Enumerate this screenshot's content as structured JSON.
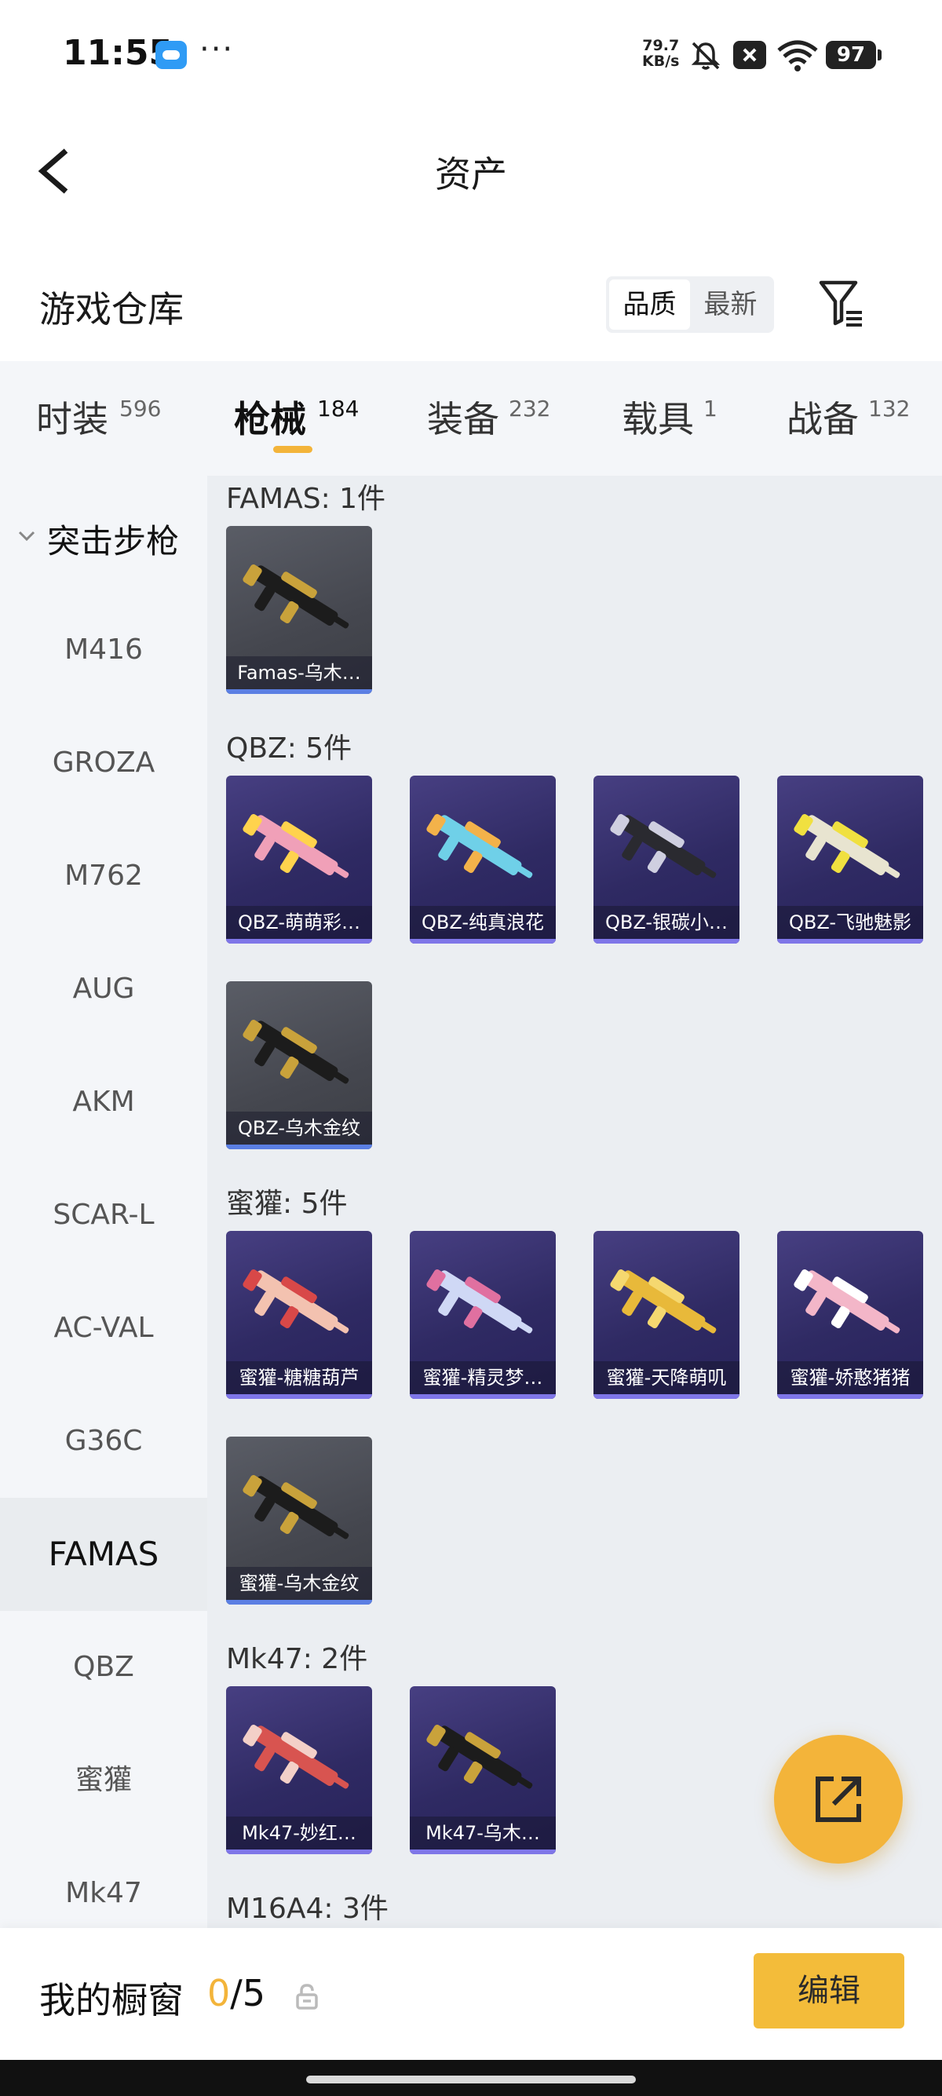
{
  "status_bar": {
    "time": "11:55",
    "more": "···",
    "net_speed_value": "79.7",
    "net_speed_unit": "KB/s",
    "battery": "97"
  },
  "header": {
    "title": "资产"
  },
  "warehouse": {
    "title": "游戏仓库",
    "sort_options": [
      "品质",
      "最新"
    ],
    "active_sort": "品质"
  },
  "tabs": [
    {
      "label": "时装",
      "count": "596"
    },
    {
      "label": "枪械",
      "count": "184"
    },
    {
      "label": "装备",
      "count": "232"
    },
    {
      "label": "载具",
      "count": "1"
    },
    {
      "label": "战备",
      "count": "132"
    }
  ],
  "active_tab": "枪械",
  "sidebar": {
    "section": "突击步枪",
    "items": [
      "M416",
      "GROZA",
      "M762",
      "AUG",
      "AKM",
      "SCAR-L",
      "AC-VAL",
      "G36C",
      "FAMAS",
      "QBZ",
      "蜜獾",
      "Mk47"
    ],
    "active_item": "FAMAS"
  },
  "groups": [
    {
      "title": "FAMAS: 1件",
      "items": [
        {
          "name": "Famas-乌木…",
          "style": "gray",
          "gun_color": "#1c1c1c",
          "accent": "#c9a23b"
        }
      ]
    },
    {
      "title": "QBZ: 5件",
      "items": [
        {
          "name": "QBZ-萌萌彩…",
          "style": "purple",
          "gun_color": "#f0a0b8",
          "accent": "#ffd34d"
        },
        {
          "name": "QBZ-纯真浪花",
          "style": "purple",
          "gun_color": "#6fd0e8",
          "accent": "#f3b24a"
        },
        {
          "name": "QBZ-银碳小…",
          "style": "purple",
          "gun_color": "#2a2a30",
          "accent": "#cfcfe0"
        },
        {
          "name": "QBZ-飞驰魅影",
          "style": "purple",
          "gun_color": "#e8e4d0",
          "accent": "#f0e040"
        },
        {
          "name": "QBZ-乌木金纹",
          "style": "gray",
          "gun_color": "#1c1c1c",
          "accent": "#c9a23b"
        }
      ]
    },
    {
      "title": "蜜獾: 5件",
      "items": [
        {
          "name": "蜜獾-糖糖葫芦",
          "style": "purple",
          "gun_color": "#f3c2b0",
          "accent": "#d84848"
        },
        {
          "name": "蜜獾-精灵梦…",
          "style": "purple",
          "gun_color": "#cfd8f5",
          "accent": "#e070a0"
        },
        {
          "name": "蜜獾-天降萌叽",
          "style": "purple",
          "gun_color": "#e8b93a",
          "accent": "#f5d870"
        },
        {
          "name": "蜜獾-娇憨猪猪",
          "style": "purple",
          "gun_color": "#f3b6c8",
          "accent": "#ffffff"
        },
        {
          "name": "蜜獾-乌木金纹",
          "style": "gray",
          "gun_color": "#1c1c1c",
          "accent": "#c9a23b"
        }
      ]
    },
    {
      "title": "Mk47: 2件",
      "items": [
        {
          "name": "Mk47-妙红…",
          "style": "purple",
          "gun_color": "#d85450",
          "accent": "#f3d0c8"
        },
        {
          "name": "Mk47-乌木…",
          "style": "purple",
          "gun_color": "#1c1c1c",
          "accent": "#c9a23b"
        }
      ]
    },
    {
      "title": "M16A4: 3件",
      "items": [
        {
          "name": "",
          "style": "purple",
          "gun_color": "#2a2a30",
          "accent": "#888"
        },
        {
          "name": "",
          "style": "purple",
          "gun_color": "#2a2a30",
          "accent": "#888"
        },
        {
          "name": "",
          "style": "purple",
          "gun_color": "#2a2a30",
          "accent": "#888"
        }
      ]
    }
  ],
  "bottom_bar": {
    "label": "我的橱窗",
    "current": "0",
    "total": "/5",
    "edit_label": "编辑"
  },
  "colors": {
    "accent": "#f3b43a",
    "sidebar_bg": "#f4f6f9",
    "content_bg": "#ebeef2"
  }
}
